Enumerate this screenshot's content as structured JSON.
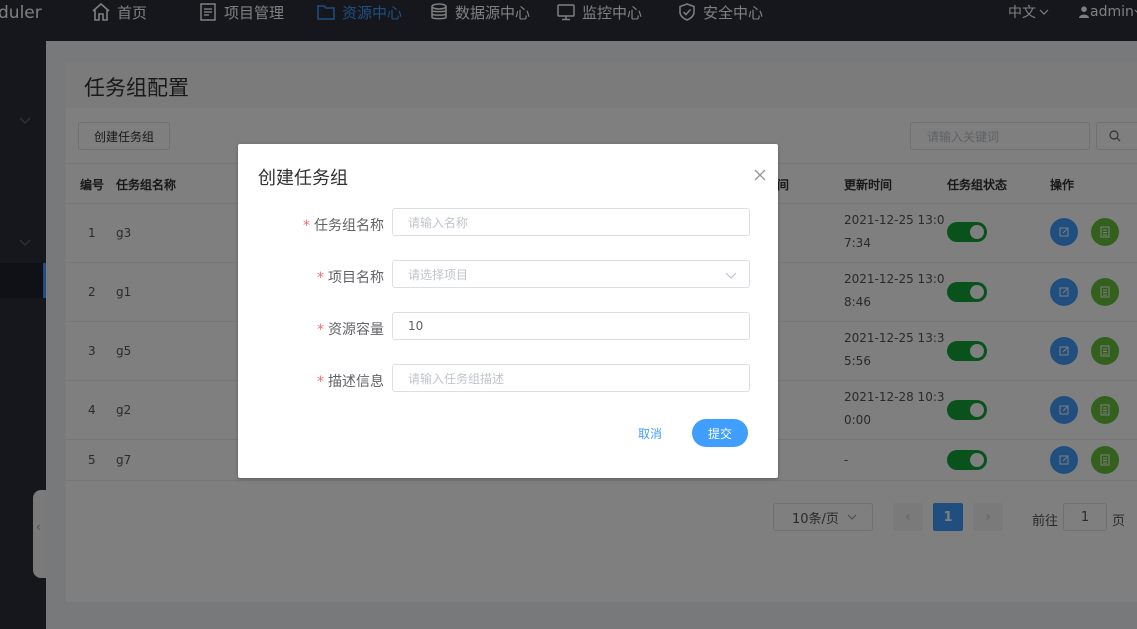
{
  "app": {
    "logo_text": "duler"
  },
  "topnav": {
    "items": [
      {
        "label": "首页",
        "icon": "home-icon"
      },
      {
        "label": "项目管理",
        "icon": "document-icon"
      },
      {
        "label": "资源中心",
        "icon": "folder-icon",
        "active": true
      },
      {
        "label": "数据源中心",
        "icon": "database-icon"
      },
      {
        "label": "监控中心",
        "icon": "monitor-icon"
      },
      {
        "label": "安全中心",
        "icon": "shield-icon"
      }
    ],
    "language": "中文",
    "user": "admin"
  },
  "page": {
    "title": "任务组配置",
    "create_button": "创建任务组",
    "search_placeholder": "请输入关键词"
  },
  "table": {
    "columns": [
      "编号",
      "任务组名称",
      "间",
      "更新时间",
      "任务组状态",
      "操作"
    ],
    "rows": [
      {
        "id": "1",
        "name": "g3",
        "updated": "2021-12-25 13:07:34",
        "status": true
      },
      {
        "id": "2",
        "name": "g1",
        "updated": "2021-12-25 13:08:46",
        "status": true
      },
      {
        "id": "3",
        "name": "g5",
        "updated": "2021-12-25 13:35:56",
        "status": true
      },
      {
        "id": "4",
        "name": "g2",
        "updated": "2021-12-28 10:30:00",
        "status": true
      },
      {
        "id": "5",
        "name": "g7",
        "updated": "-",
        "status": true
      }
    ]
  },
  "pagination": {
    "page_size": "10条/页",
    "current": "1",
    "goto_label": "前往",
    "goto_value": "1",
    "goto_unit": "页"
  },
  "modal": {
    "title": "创建任务组",
    "fields": [
      {
        "label": "任务组名称",
        "placeholder": "请输入名称",
        "value": ""
      },
      {
        "label": "项目名称",
        "placeholder": "请选择项目",
        "value": ""
      },
      {
        "label": "资源容量",
        "placeholder": "",
        "value": "10"
      },
      {
        "label": "描述信息",
        "placeholder": "请输入任务组描述",
        "value": ""
      }
    ],
    "required_mark": "*",
    "cancel_label": "取消",
    "submit_label": "提交"
  },
  "colors": {
    "accent": "#409eff",
    "nav_bg": "#2b2f3a",
    "switch_on": "#13a538",
    "delete_btn": "#67c23a",
    "required": "#f56c6c"
  }
}
